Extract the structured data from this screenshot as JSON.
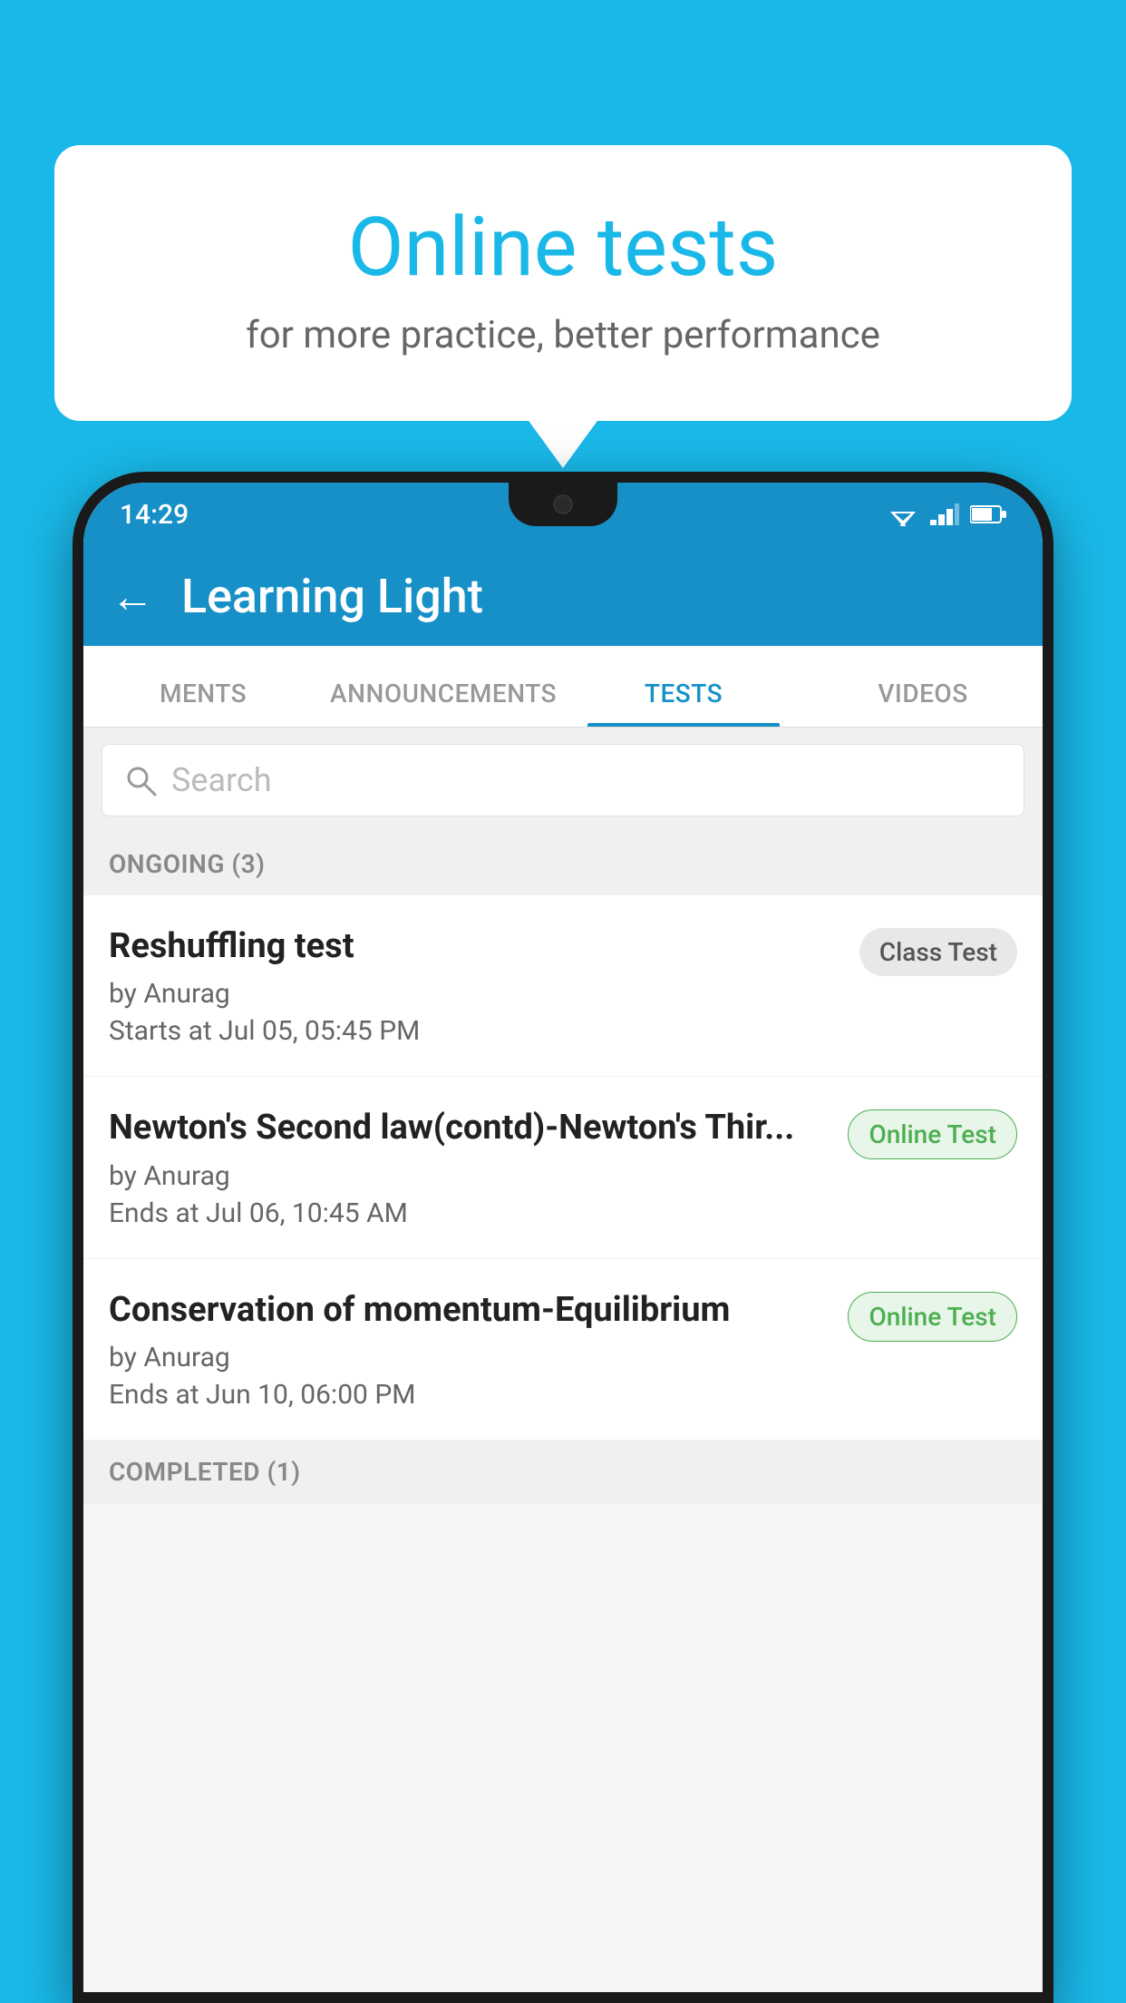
{
  "background_color": "#1ab8e8",
  "bubble": {
    "title": "Online tests",
    "subtitle": "for more practice, better performance"
  },
  "status_bar": {
    "time": "14:29",
    "icons": [
      "wifi",
      "signal",
      "battery"
    ]
  },
  "app_bar": {
    "back_label": "←",
    "title": "Learning Light"
  },
  "tabs": [
    {
      "label": "MENTS",
      "active": false
    },
    {
      "label": "ANNOUNCEMENTS",
      "active": false
    },
    {
      "label": "TESTS",
      "active": true
    },
    {
      "label": "VIDEOS",
      "active": false
    }
  ],
  "search": {
    "placeholder": "Search"
  },
  "sections": [
    {
      "header": "ONGOING (3)",
      "tests": [
        {
          "name": "Reshuffling test",
          "author": "by Anurag",
          "time": "Starts at  Jul 05, 05:45 PM",
          "badge": "Class Test",
          "badge_type": "class"
        },
        {
          "name": "Newton's Second law(contd)-Newton's Thir...",
          "author": "by Anurag",
          "time": "Ends at  Jul 06, 10:45 AM",
          "badge": "Online Test",
          "badge_type": "online"
        },
        {
          "name": "Conservation of momentum-Equilibrium",
          "author": "by Anurag",
          "time": "Ends at  Jun 10, 06:00 PM",
          "badge": "Online Test",
          "badge_type": "online"
        }
      ]
    }
  ],
  "completed_section": {
    "header": "COMPLETED (1)"
  }
}
